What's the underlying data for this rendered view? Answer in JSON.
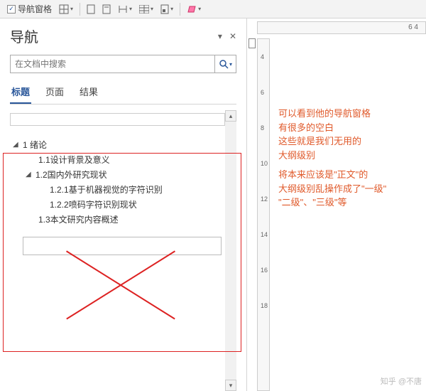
{
  "toolbar": {
    "nav_label": "导航窗格"
  },
  "nav": {
    "title": "导航",
    "search_placeholder": "在文档中搜索",
    "tabs": {
      "headings": "标题",
      "pages": "页面",
      "results": "结果"
    },
    "outline": {
      "root": "1 绪论",
      "i11": "1.1设计背景及意义",
      "i12": "1.2国内外研究现状",
      "i121": "1.2.1基于机器视觉的字符识别",
      "i122": "1.2.2喷码字符识别现状",
      "i13": "1.3本文研究内容概述"
    }
  },
  "ruler": {
    "top_marks": "6    4",
    "ticks": [
      "4",
      "6",
      "8",
      "10",
      "12",
      "14",
      "16",
      "18"
    ]
  },
  "annotation": {
    "p1": "可以看到他的导航窗格",
    "p2": "有很多的空白",
    "p3": "这些就是我们无用的",
    "p4": "大纲级别",
    "p5": "将本来应该是\"正文\"的",
    "p6": "大纲级别乱操作成了\"一级\"",
    "p7": "\"二级\"、\"三级\"等"
  },
  "watermark": "知乎 @不唐"
}
